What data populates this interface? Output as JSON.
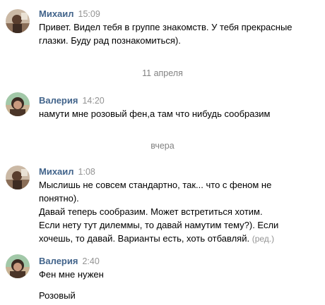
{
  "dividers": {
    "d1": "11 апреля",
    "d2": "вчера"
  },
  "messages": [
    {
      "author": "Михаил",
      "time": "15:09",
      "lines": [
        "Привет. Видел тебя в группе знакомств. У тебя прекрасные",
        "глазки. Буду рад познакомиться)."
      ]
    },
    {
      "author": "Валерия",
      "time": "14:20",
      "lines": [
        "намути мне розовый фен,а там что нибудь сообразим"
      ]
    },
    {
      "author": "Михаил",
      "time": "1:08",
      "lines": [
        "Мыслишь не совсем стандартно, так... что с феном не",
        "понятно).",
        "Давай теперь сообразим. Может встретиться хотим.",
        "Если нету тут дилеммы, то давай намутим тему?). Если",
        "хочешь, то давай. Варианты есть, хоть отбавляй."
      ],
      "edited_label": "(ред.)"
    },
    {
      "author": "Валерия",
      "time": "2:40",
      "lines": [
        "Фен мне нужен",
        "Розовый"
      ]
    }
  ],
  "colors": {
    "author": "#42648b",
    "time": "#939393",
    "text": "#000000",
    "divider": "#828282"
  },
  "icons": {
    "avatar_mikhail": "user-photo",
    "avatar_valeria": "user-photo"
  }
}
